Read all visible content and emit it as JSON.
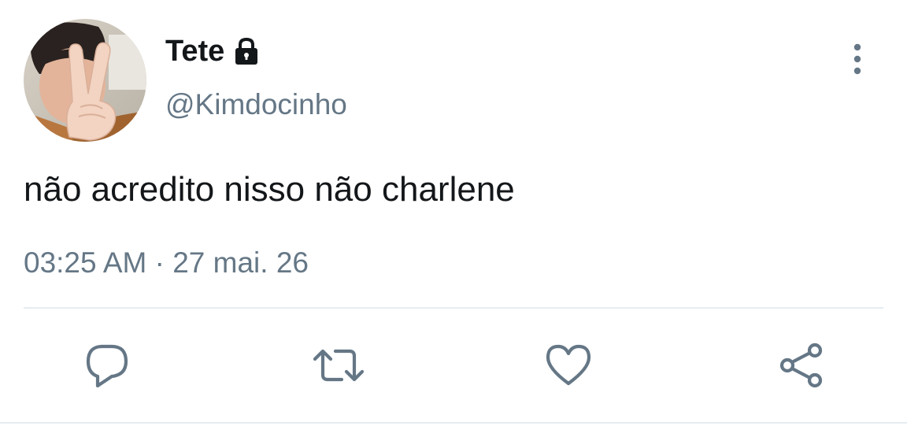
{
  "tweet": {
    "author": {
      "display_name": "Tete",
      "handle": "@Kimdocinho",
      "protected_icon": "lock-icon",
      "avatar": "profile-photo"
    },
    "text": "não acredito nisso não charlene",
    "timestamp": "03:25 AM · 27 mai. 26"
  },
  "actions": [
    {
      "name": "reply",
      "icon": "reply-icon"
    },
    {
      "name": "retweet",
      "icon": "retweet-icon"
    },
    {
      "name": "like",
      "icon": "heart-icon"
    },
    {
      "name": "share",
      "icon": "share-icon"
    }
  ],
  "menu_icon": "more-vertical-icon",
  "colors": {
    "text_primary": "#14171a",
    "text_secondary": "#657786",
    "icon": "#657786",
    "divider": "#e6ecf0",
    "background": "#ffffff"
  }
}
